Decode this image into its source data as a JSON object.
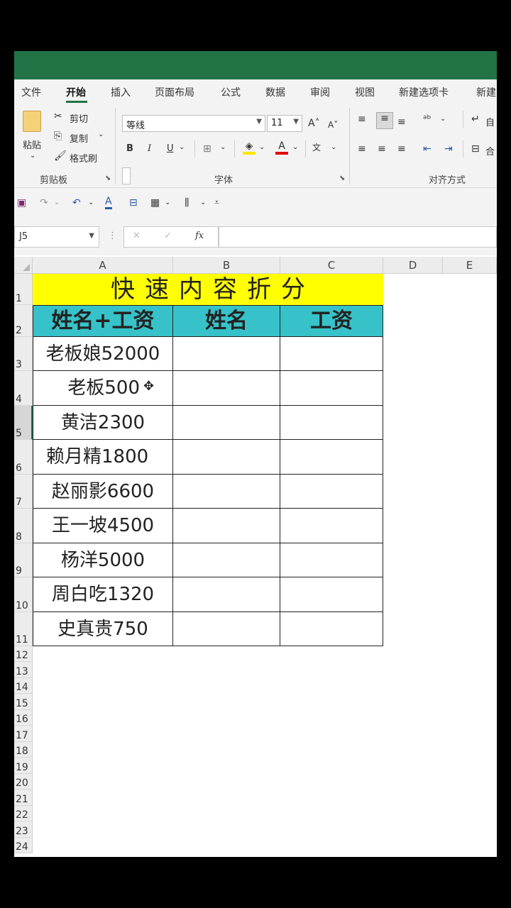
{
  "ribbon_tabs": [
    "文件",
    "开始",
    "插入",
    "页面布局",
    "公式",
    "数据",
    "审阅",
    "视图",
    "新建选项卡",
    "新建"
  ],
  "active_tab": "开始",
  "clipboard": {
    "paste_label": "粘贴",
    "cut_label": "剪切",
    "copy_label": "复制",
    "format_painter_label": "格式刷",
    "group_label": "剪贴板"
  },
  "font": {
    "font_name": "等线",
    "font_size": "11",
    "bold": "B",
    "italic": "I",
    "underline": "U",
    "group_label": "字体"
  },
  "alignment": {
    "wrap_label": "自",
    "merge_label": "合",
    "group_label": "对齐方式"
  },
  "formula_bar": {
    "name_box": "J5",
    "fx_label": "fx",
    "cancel": "✕",
    "confirm": "✓",
    "formula": ""
  },
  "columns": [
    "A",
    "B",
    "C",
    "D",
    "E"
  ],
  "rows": [
    "1",
    "2",
    "3",
    "4",
    "5",
    "6",
    "7",
    "8",
    "9",
    "10",
    "11",
    "12",
    "13",
    "14",
    "15",
    "16",
    "17",
    "18",
    "19",
    "20",
    "21",
    "22",
    "23",
    "24"
  ],
  "table": {
    "title": "快速内容折分",
    "headers": [
      "姓名+工资",
      "姓名",
      "工资"
    ],
    "data": [
      "老板娘52000",
      "老板500",
      "黄洁2300",
      "赖月精1800",
      "赵丽影6600",
      "王一坡4500",
      "杨洋5000",
      "周白吃1320",
      "史真贵750"
    ]
  },
  "colors": {
    "title_fill": "#ffff00",
    "header_fill": "#36c2c8",
    "excel_green": "#217346"
  }
}
